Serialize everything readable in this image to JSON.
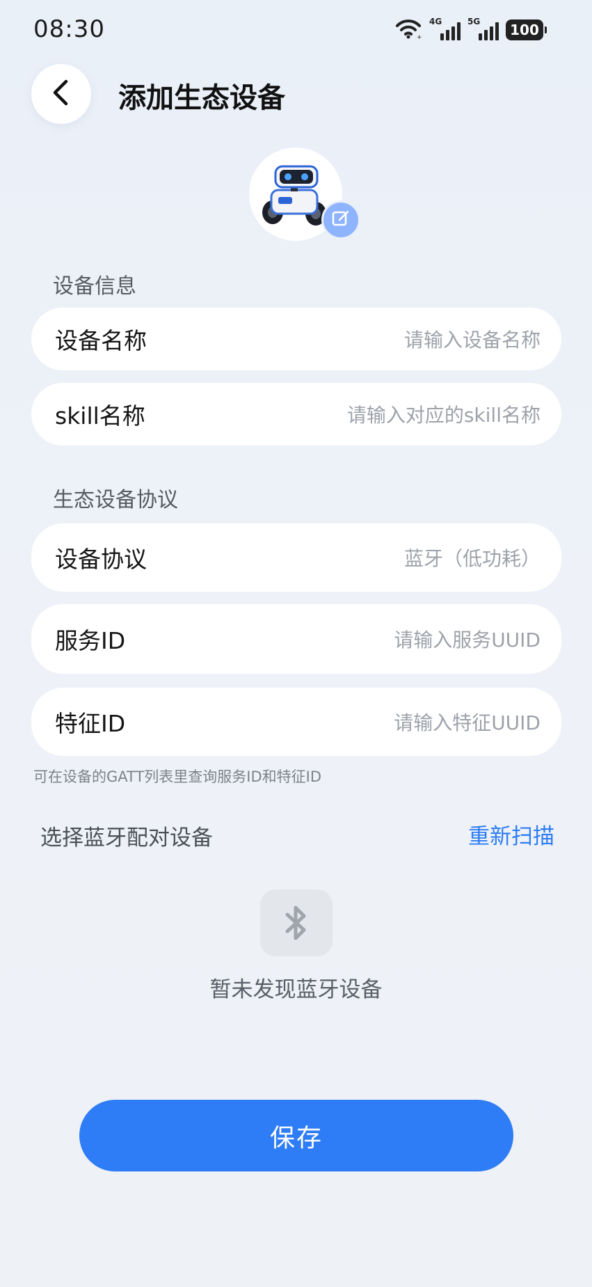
{
  "status_bar": {
    "time": "08:30",
    "network_1": "4G",
    "network_2": "5G",
    "battery": "100"
  },
  "header": {
    "back_icon": "chevron-left-icon",
    "title": "添加生态设备"
  },
  "avatar": {
    "image": "robot-device-image",
    "edit_icon": "edit-pencil-icon"
  },
  "device_info": {
    "section_label": "设备信息",
    "name_label": "设备名称",
    "name_placeholder": "请输入设备名称",
    "skill_label": "skill名称",
    "skill_placeholder": "请输入对应的skill名称"
  },
  "protocol": {
    "section_label": "生态设备协议",
    "protocol_label": "设备协议",
    "protocol_value": "蓝牙（低功耗）",
    "service_label": "服务ID",
    "service_placeholder": "请输入服务UUID",
    "feature_label": "特征ID",
    "feature_placeholder": "请输入特征UUID",
    "hint": "可在设备的GATT列表里查询服务ID和特征ID"
  },
  "bluetooth": {
    "title": "选择蓝牙配对设备",
    "rescan_label": "重新扫描",
    "empty_icon": "bluetooth-icon",
    "empty_text": "暂未发现蓝牙设备"
  },
  "footer": {
    "save_label": "保存"
  },
  "colors": {
    "accent": "#2e7cf6",
    "background": "#eaf0f8",
    "card": "#ffffff",
    "placeholder": "#9da2aa"
  }
}
